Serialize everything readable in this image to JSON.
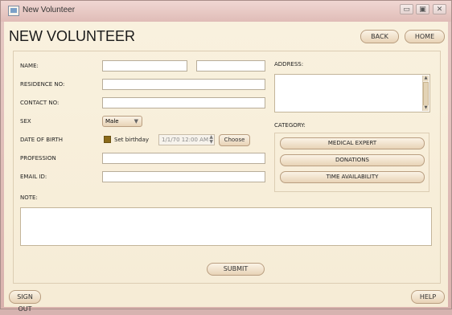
{
  "window": {
    "title": "New Volunteer",
    "controls": {
      "minimize": "▭",
      "maximize": "▣",
      "close": "✕"
    }
  },
  "header": {
    "title": "NEW VOLUNTEER",
    "back_label": "BACK",
    "home_label": "HOME"
  },
  "form": {
    "name_label": "NAME:",
    "residence_label": "RESIDENCE NO:",
    "contact_label": "CONTACT NO:",
    "sex_label": "SEX",
    "sex_value": "Male",
    "dob_label": "DATE OF BIRTH",
    "set_birthday_label": "Set birthday",
    "date_value": "1/1/70 12:00 AM",
    "choose_label": "Choose",
    "profession_label": "PROFESSION",
    "email_label": "EMAIL ID:",
    "address_label": "ADDRESS:",
    "note_label": "NOTE:",
    "category_label": "CATEGORY:",
    "categories": [
      "MEDICAL EXPERT",
      "DONATIONS",
      "TIME AVAILABILITY"
    ],
    "submit_label": "SUBMIT"
  },
  "footer": {
    "sign_out_label": "SIGN OUT",
    "help_label": "HELP"
  },
  "colors": {
    "panel_bg": "#f9f1de",
    "button_border": "#b99e80",
    "checkbox_fill": "#8a6a1a"
  }
}
